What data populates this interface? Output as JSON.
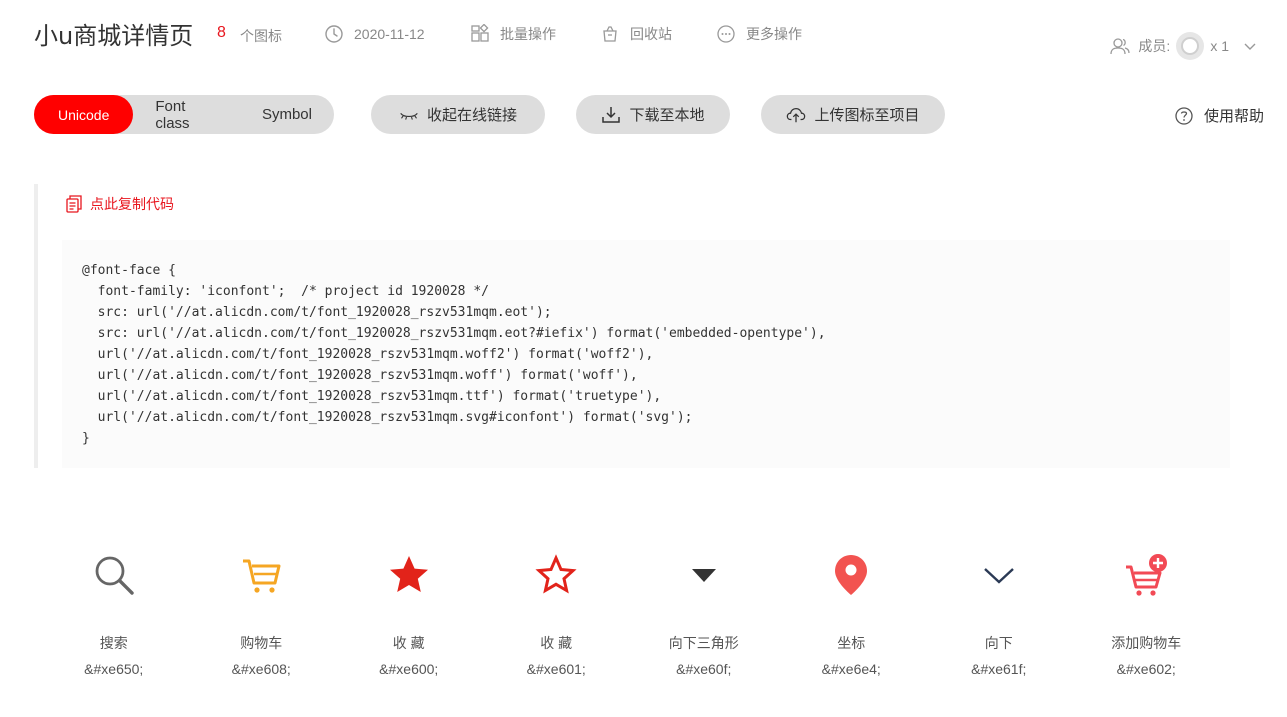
{
  "header": {
    "title": "小u商城详情页",
    "icon_count": "8",
    "icon_count_label": "个图标",
    "date": "2020-11-12",
    "batch_label": "批量操作",
    "recycle_label": "回收站",
    "more_label": "更多操作",
    "member_label": "成员:",
    "member_count": "x 1"
  },
  "toolbar": {
    "tabs": [
      {
        "label": "Unicode",
        "active": true
      },
      {
        "label": "Font class",
        "active": false
      },
      {
        "label": "Symbol",
        "active": false
      }
    ],
    "collapse_label": "收起在线链接",
    "download_label": "下载至本地",
    "upload_label": "上传图标至项目",
    "help_label": "使用帮助"
  },
  "code": {
    "copy_label": "点此复制代码",
    "text": "@font-face {\n  font-family: 'iconfont';  /* project id 1920028 */\n  src: url('//at.alicdn.com/t/font_1920028_rszv531mqm.eot');\n  src: url('//at.alicdn.com/t/font_1920028_rszv531mqm.eot?#iefix') format('embedded-opentype'),\n  url('//at.alicdn.com/t/font_1920028_rszv531mqm.woff2') format('woff2'),\n  url('//at.alicdn.com/t/font_1920028_rszv531mqm.woff') format('woff'),\n  url('//at.alicdn.com/t/font_1920028_rszv531mqm.ttf') format('truetype'),\n  url('//at.alicdn.com/t/font_1920028_rszv531mqm.svg#iconfont') format('svg');\n}"
  },
  "icons": [
    {
      "name": "搜索",
      "code": "&#xe650;",
      "icon": "search-icon",
      "color": "#666666"
    },
    {
      "name": "购物车",
      "code": "&#xe608;",
      "icon": "cart-icon",
      "color": "#f5a623"
    },
    {
      "name": "收 藏",
      "code": "&#xe600;",
      "icon": "star-filled-icon",
      "color": "#e2231a"
    },
    {
      "name": "收 藏",
      "code": "&#xe601;",
      "icon": "star-outline-icon",
      "color": "#e2231a"
    },
    {
      "name": "向下三角形",
      "code": "&#xe60f;",
      "icon": "triangle-down-icon",
      "color": "#333333"
    },
    {
      "name": "坐标",
      "code": "&#xe6e4;",
      "icon": "location-pin-icon",
      "color": "#f25350"
    },
    {
      "name": "向下",
      "code": "&#xe61f;",
      "icon": "chevron-down-icon",
      "color": "#2b3a55"
    },
    {
      "name": "添加购物车",
      "code": "&#xe602;",
      "icon": "add-cart-icon",
      "color": "#f24a55"
    }
  ],
  "colors": {
    "accent": "#ff0000",
    "pill_bg": "#dddddd"
  }
}
